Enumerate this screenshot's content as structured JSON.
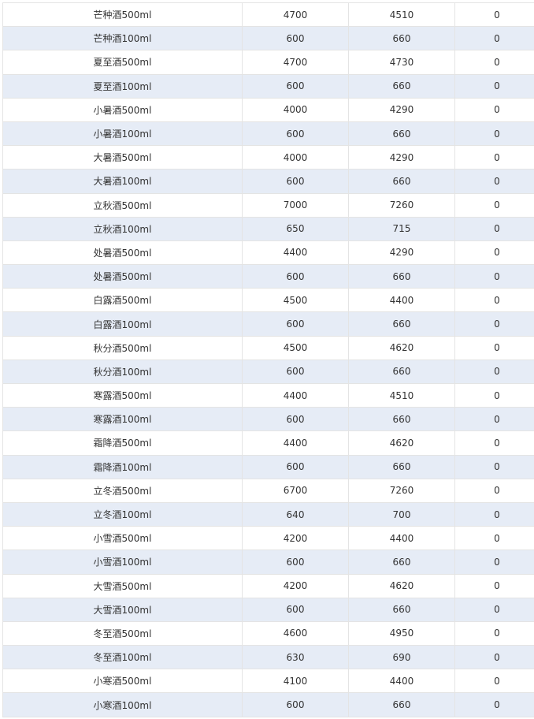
{
  "table": {
    "rows": [
      {
        "name": "芒种酒500ml",
        "a": "4700",
        "b": "4510",
        "c": "0"
      },
      {
        "name": "芒种酒100ml",
        "a": "600",
        "b": "660",
        "c": "0"
      },
      {
        "name": "夏至酒500ml",
        "a": "4700",
        "b": "4730",
        "c": "0"
      },
      {
        "name": "夏至酒100ml",
        "a": "600",
        "b": "660",
        "c": "0"
      },
      {
        "name": "小暑酒500ml",
        "a": "4000",
        "b": "4290",
        "c": "0"
      },
      {
        "name": "小暑酒100ml",
        "a": "600",
        "b": "660",
        "c": "0"
      },
      {
        "name": "大暑酒500ml",
        "a": "4000",
        "b": "4290",
        "c": "0"
      },
      {
        "name": "大暑酒100ml",
        "a": "600",
        "b": "660",
        "c": "0"
      },
      {
        "name": "立秋酒500ml",
        "a": "7000",
        "b": "7260",
        "c": "0"
      },
      {
        "name": "立秋酒100ml",
        "a": "650",
        "b": "715",
        "c": "0"
      },
      {
        "name": "处暑酒500ml",
        "a": "4400",
        "b": "4290",
        "c": "0"
      },
      {
        "name": "处暑酒500ml",
        "a": "600",
        "b": "660",
        "c": "0"
      },
      {
        "name": "白露酒500ml",
        "a": "4500",
        "b": "4400",
        "c": "0"
      },
      {
        "name": "白露酒100ml",
        "a": "600",
        "b": "660",
        "c": "0"
      },
      {
        "name": "秋分酒500ml",
        "a": "4500",
        "b": "4620",
        "c": "0"
      },
      {
        "name": "秋分酒100ml",
        "a": "600",
        "b": "660",
        "c": "0"
      },
      {
        "name": "寒露酒500ml",
        "a": "4400",
        "b": "4510",
        "c": "0"
      },
      {
        "name": "寒露酒100ml",
        "a": "600",
        "b": "660",
        "c": "0"
      },
      {
        "name": "霜降酒500ml",
        "a": "4400",
        "b": "4620",
        "c": "0"
      },
      {
        "name": "霜降酒100ml",
        "a": "600",
        "b": "660",
        "c": "0"
      },
      {
        "name": "立冬酒500ml",
        "a": "6700",
        "b": "7260",
        "c": "0"
      },
      {
        "name": "立冬酒100ml",
        "a": "640",
        "b": "700",
        "c": "0"
      },
      {
        "name": "小雪酒500ml",
        "a": "4200",
        "b": "4400",
        "c": "0"
      },
      {
        "name": "小雪酒100ml",
        "a": "600",
        "b": "660",
        "c": "0"
      },
      {
        "name": "大雪酒500ml",
        "a": "4200",
        "b": "4620",
        "c": "0"
      },
      {
        "name": "大雪酒100ml",
        "a": "600",
        "b": "660",
        "c": "0"
      },
      {
        "name": "冬至酒500ml",
        "a": "4600",
        "b": "4950",
        "c": "0"
      },
      {
        "name": "冬至酒100ml",
        "a": "630",
        "b": "690",
        "c": "0"
      },
      {
        "name": "小寒酒500ml",
        "a": "4100",
        "b": "4400",
        "c": "0"
      },
      {
        "name": "小寒酒100ml",
        "a": "600",
        "b": "660",
        "c": "0"
      }
    ]
  }
}
